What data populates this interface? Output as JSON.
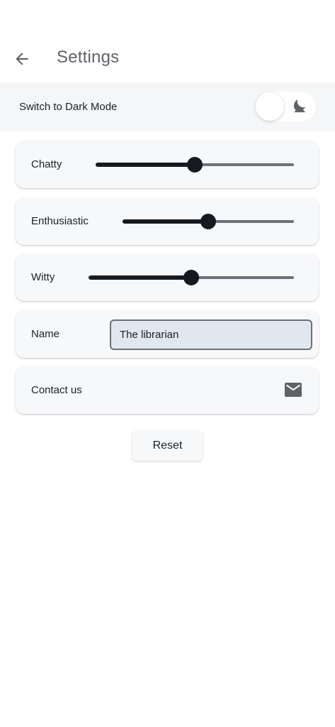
{
  "header": {
    "title": "Settings",
    "back_icon": "arrow-left-icon"
  },
  "dark_mode": {
    "label": "Switch to Dark Mode",
    "enabled": false,
    "icon": "moon-icon"
  },
  "sliders": [
    {
      "label": "Chatty",
      "value": 0.5
    },
    {
      "label": "Enthusiastic",
      "value": 0.5
    },
    {
      "label": "Witty",
      "value": 0.5
    }
  ],
  "name": {
    "label": "Name",
    "value": "The librarian"
  },
  "contact": {
    "label": "Contact us",
    "icon": "mail-icon"
  },
  "reset": {
    "label": "Reset"
  },
  "colors": {
    "slider_active": "#141a1f",
    "slider_inactive": "#6b7176",
    "card_background": "#f7f8fa",
    "input_background": "#e1e7ef",
    "title_color": "#5f6368"
  }
}
